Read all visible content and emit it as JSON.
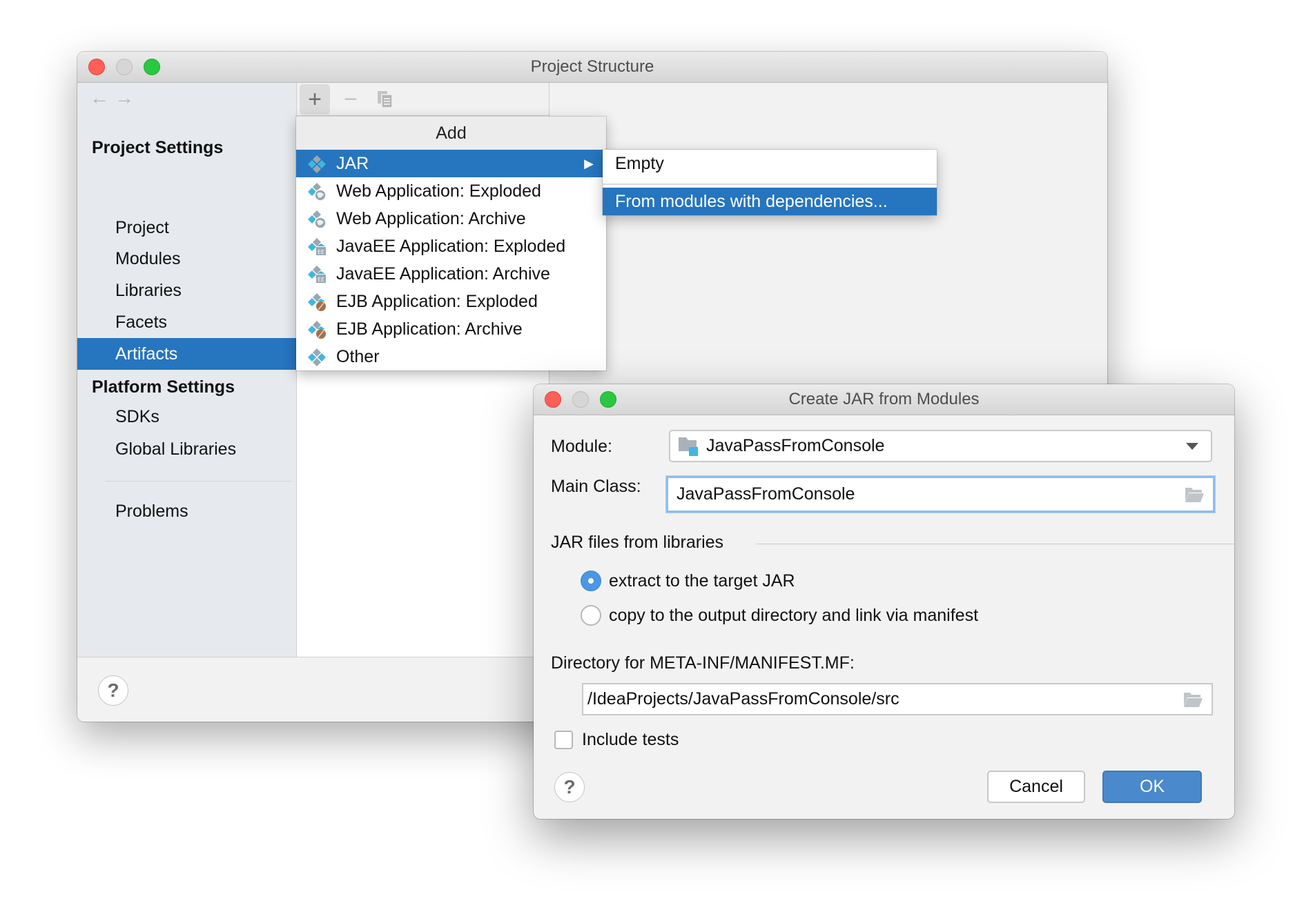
{
  "main_window": {
    "title": "Project Structure",
    "nav": {
      "back_icon": "arrow-left-icon",
      "forward_icon": "arrow-right-icon",
      "back_glyph": "←",
      "forward_glyph": "→"
    },
    "sidebar": {
      "project_settings_header": "Project Settings",
      "project_items": [
        "Project",
        "Modules",
        "Libraries",
        "Facets",
        "Artifacts"
      ],
      "selected_item": "Artifacts",
      "platform_settings_header": "Platform Settings",
      "platform_items": [
        "SDKs",
        "Global Libraries"
      ],
      "problems": "Problems"
    },
    "toolbar": {
      "add_glyph": "+",
      "remove_glyph": "−",
      "copy_icon": "copy-icon"
    },
    "footer": {
      "help_glyph": "?"
    }
  },
  "add_popup": {
    "title": "Add",
    "items": [
      {
        "label": "JAR",
        "icon": "jar-artifact-icon",
        "selected": true,
        "has_submenu": true
      },
      {
        "label": "Web Application: Exploded",
        "icon": "web-artifact-icon"
      },
      {
        "label": "Web Application: Archive",
        "icon": "web-artifact-icon"
      },
      {
        "label": "JavaEE Application: Exploded",
        "icon": "javaee-artifact-icon"
      },
      {
        "label": "JavaEE Application: Archive",
        "icon": "javaee-artifact-icon"
      },
      {
        "label": "EJB Application: Exploded",
        "icon": "ejb-artifact-icon"
      },
      {
        "label": "EJB Application: Archive",
        "icon": "ejb-artifact-icon"
      },
      {
        "label": "Other",
        "icon": "artifact-icon"
      }
    ],
    "submenu_glyph": "▶"
  },
  "submenu": {
    "items": [
      {
        "label": "Empty",
        "selected": false
      },
      {
        "label": "From modules with dependencies...",
        "selected": true
      }
    ]
  },
  "jar_dialog": {
    "title": "Create JAR from Modules",
    "module_label": "Module:",
    "module_value": "JavaPassFromConsole",
    "main_class_label": "Main Class:",
    "main_class_value": "JavaPassFromConsole",
    "libraries_group_label": "JAR files from libraries",
    "radio_options": [
      {
        "label": "extract to the target JAR",
        "checked": true
      },
      {
        "label": "copy to the output directory and link via manifest",
        "checked": false
      }
    ],
    "manifest_dir_label": "Directory for META-INF/MANIFEST.MF:",
    "manifest_dir_value": "/IdeaProjects/JavaPassFromConsole/src",
    "include_tests_label": "Include tests",
    "include_tests_checked": false,
    "help_glyph": "?",
    "cancel_label": "Cancel",
    "ok_label": "OK"
  },
  "colors": {
    "selection": "#2675bf",
    "ok_button": "#4a89cc",
    "radio_on": "#4a97e4",
    "focus_ring": "#8fbdf0",
    "sidebar_bg": "#e6eaee",
    "close": "#fe5f57",
    "maximize": "#29c840"
  }
}
